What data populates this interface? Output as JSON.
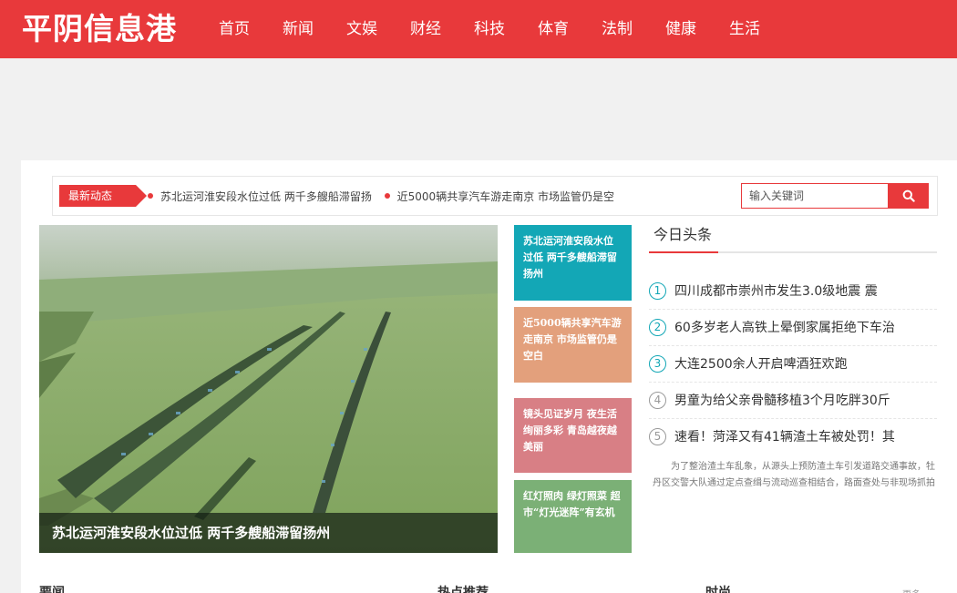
{
  "site": {
    "logo": "平阴信息港"
  },
  "nav": [
    "首页",
    "新闻",
    "文娱",
    "财经",
    "科技",
    "体育",
    "法制",
    "健康",
    "生活"
  ],
  "ticker": {
    "label": "最新动态",
    "items": [
      "苏北运河淮安段水位过低 两千多艘船滞留扬",
      "近5000辆共享汽车游走南京 市场监管仍是空"
    ]
  },
  "search": {
    "placeholder": "输入关键词",
    "icon": "search-icon"
  },
  "hero": {
    "caption": "苏北运河淮安段水位过低 两千多艘船滞留扬州"
  },
  "tiles": [
    {
      "text": "苏北运河淮安段水位过低 两千多艘船滞留扬州",
      "color": "#13a7b6"
    },
    {
      "text": "近5000辆共享汽车游走南京 市场监管仍是空白",
      "color": "#e3a07c"
    },
    {
      "text": "镜头见证岁月 夜生活绚丽多彩 青岛越夜越美丽",
      "color": "#d87f85"
    },
    {
      "text": "红灯照肉 绿灯照菜 超市“灯光迷阵”有玄机",
      "color": "#7bb076"
    }
  ],
  "headlines": {
    "title": "今日头条",
    "items": [
      {
        "num": "1",
        "text": "四川成都市崇州市发生3.0级地震 震"
      },
      {
        "num": "2",
        "text": "60多岁老人高铁上晕倒家属拒绝下车治"
      },
      {
        "num": "3",
        "text": "大连2500余人开启啤酒狂欢跑"
      },
      {
        "num": "4",
        "text": "男童为给父亲骨髓移植3个月吃胖30斤"
      },
      {
        "num": "5",
        "text": "速看！菏泽又有41辆渣土车被处罚！其"
      }
    ],
    "desc": "为了整治渣土车乱象，从源头上预防渣土车引发道路交通事故，牡丹区交警大队通过定点查缉与流动巡查相结合，路面查处与非现场抓拍"
  },
  "sections": {
    "left": "要闻",
    "middle": "热点推荐",
    "right": "时尚",
    "more": "更多"
  },
  "colors": {
    "brand": "#e8393b",
    "accent": "#13a7b6"
  }
}
